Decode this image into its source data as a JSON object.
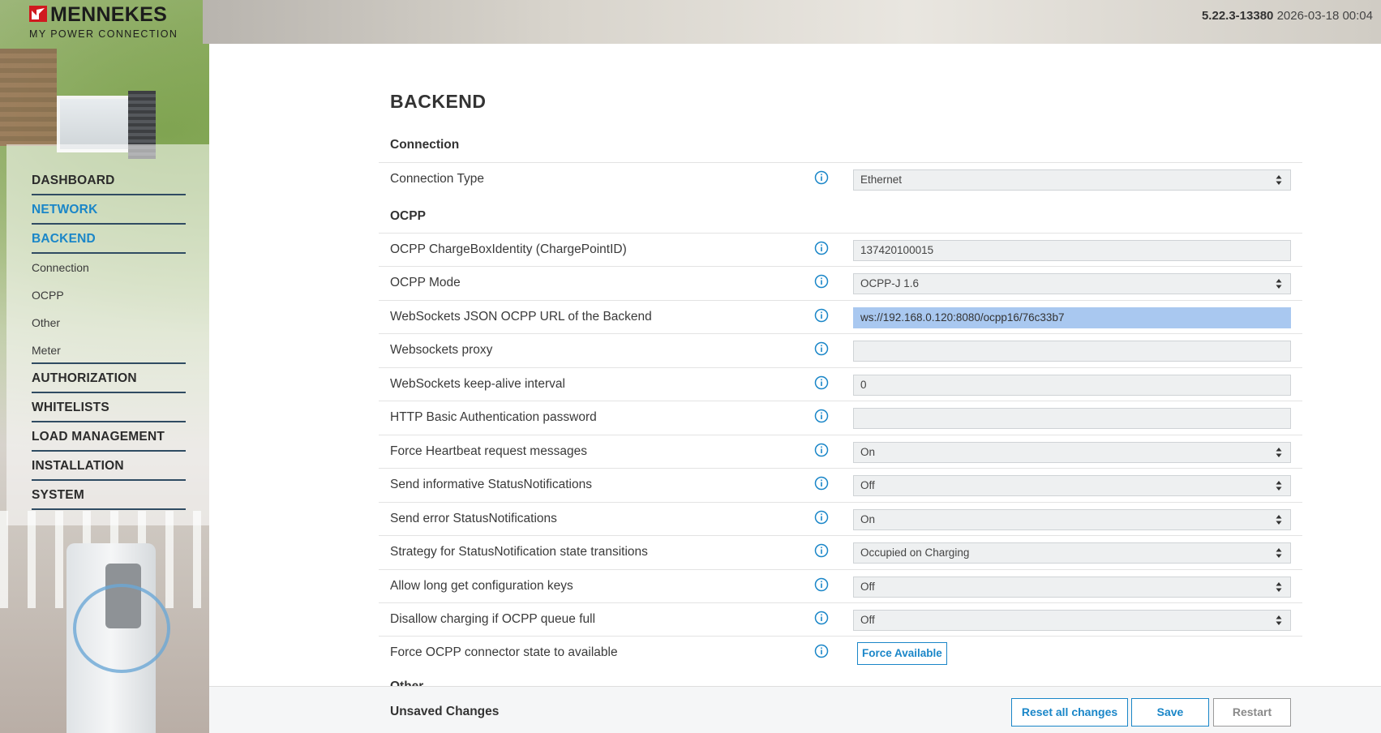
{
  "header": {
    "brand": "MENNEKES",
    "tagline": "MY POWER CONNECTION",
    "version": "5.22.3-13380",
    "datetime": "2026-03-18 00:04"
  },
  "nav": {
    "items": [
      {
        "label": "DASHBOARD"
      },
      {
        "label": "NETWORK"
      },
      {
        "label": "BACKEND"
      },
      {
        "label": "AUTHORIZATION"
      },
      {
        "label": "WHITELISTS"
      },
      {
        "label": "LOAD MANAGEMENT"
      },
      {
        "label": "INSTALLATION"
      },
      {
        "label": "SYSTEM"
      }
    ],
    "backend_sub": [
      {
        "label": "Connection"
      },
      {
        "label": "OCPP"
      },
      {
        "label": "Other"
      },
      {
        "label": "Meter"
      }
    ]
  },
  "page": {
    "title": "BACKEND",
    "sections": {
      "connection": "Connection",
      "ocpp": "OCPP",
      "other": "Other"
    }
  },
  "rows": {
    "connection_type": {
      "label": "Connection Type",
      "value": "Ethernet"
    },
    "charge_box_identity": {
      "label": "OCPP ChargeBoxIdentity (ChargePointID)",
      "value": "137420100015"
    },
    "ocpp_mode": {
      "label": "OCPP Mode",
      "value": "OCPP-J 1.6"
    },
    "ws_url": {
      "label": "WebSockets JSON OCPP URL of the Backend",
      "value": "ws://192.168.0.120:8080/ocpp16/76c33b7"
    },
    "ws_proxy": {
      "label": "Websockets proxy",
      "value": ""
    },
    "ws_keepalive": {
      "label": "WebSockets keep-alive interval",
      "value": "0"
    },
    "http_password": {
      "label": "HTTP Basic Authentication password",
      "value": ""
    },
    "force_heartbeat": {
      "label": "Force Heartbeat request messages",
      "value": "On"
    },
    "info_status": {
      "label": "Send informative StatusNotifications",
      "value": "Off"
    },
    "error_status": {
      "label": "Send error StatusNotifications",
      "value": "On"
    },
    "status_strategy": {
      "label": "Strategy for StatusNotification state transitions",
      "value": "Occupied on Charging"
    },
    "long_config_keys": {
      "label": "Allow long get configuration keys",
      "value": "Off"
    },
    "disallow_queue_full": {
      "label": "Disallow charging if OCPP queue full",
      "value": "Off"
    },
    "force_available": {
      "label": "Force OCPP connector state to available",
      "button": "Force Available"
    }
  },
  "footer": {
    "unsaved": "Unsaved Changes",
    "reset": "Reset all changes",
    "save": "Save",
    "restart": "Restart"
  },
  "colors": {
    "accent": "#1a86c8",
    "brand_red": "#d01a1f",
    "selection": "#a9c8f0"
  },
  "icons": {
    "info": "info-icon",
    "select": "select-arrows-icon",
    "logo": "mennekes-logo-mark"
  }
}
